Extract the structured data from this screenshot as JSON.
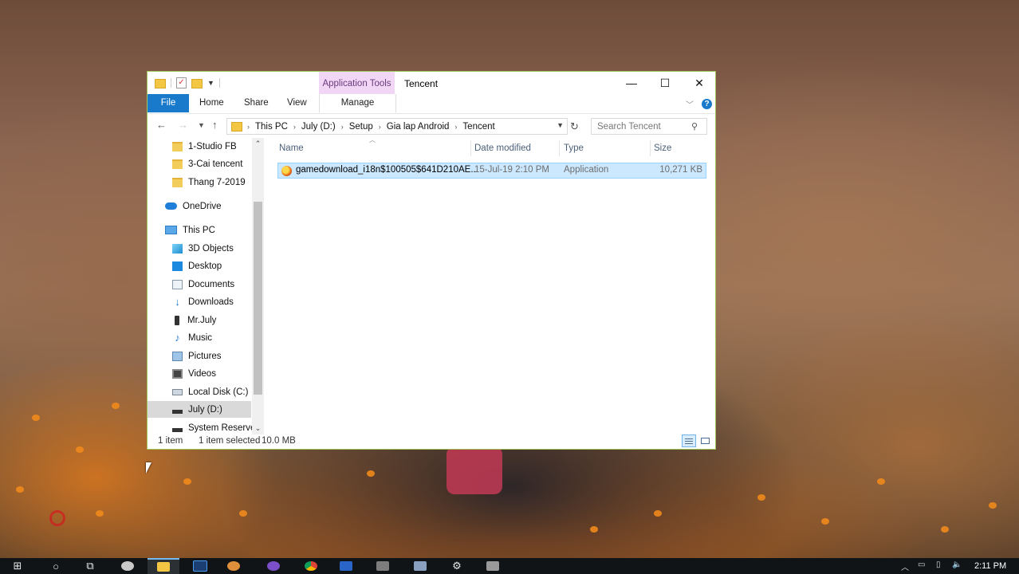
{
  "window": {
    "title": "Tencent",
    "context_tab": "Application Tools",
    "ribbon_tabs": [
      "File",
      "Home",
      "Share",
      "View",
      "Manage"
    ],
    "controls": {
      "minimize": "—",
      "maximize": "☐",
      "close": "✕"
    }
  },
  "address_bar": {
    "path": [
      "This PC",
      "July (D:)",
      "Setup",
      "Gia lap Android",
      "Tencent"
    ]
  },
  "search": {
    "placeholder": "Search Tencent"
  },
  "nav_pane": {
    "items": [
      {
        "label": "1-Studio FB",
        "icon": "folder-icon"
      },
      {
        "label": "3-Cai tencent",
        "icon": "folder-icon"
      },
      {
        "label": "Thang 7-2019",
        "icon": "folder-icon"
      },
      {
        "label": "OneDrive",
        "icon": "onedrive-icon"
      },
      {
        "label": "This PC",
        "icon": "this-pc-icon"
      },
      {
        "label": "3D Objects",
        "icon": "3d-objects-icon"
      },
      {
        "label": "Desktop",
        "icon": "desktop-icon"
      },
      {
        "label": "Documents",
        "icon": "documents-icon"
      },
      {
        "label": "Downloads",
        "icon": "downloads-icon"
      },
      {
        "label": "Mr.July",
        "icon": "phone-icon"
      },
      {
        "label": "Music",
        "icon": "music-icon"
      },
      {
        "label": "Pictures",
        "icon": "pictures-icon"
      },
      {
        "label": "Videos",
        "icon": "videos-icon"
      },
      {
        "label": "Local Disk (C:)",
        "icon": "local-disk-icon"
      },
      {
        "label": "July (D:)",
        "icon": "drive-icon",
        "selected": true
      },
      {
        "label": "System Reservec",
        "icon": "drive-icon"
      }
    ]
  },
  "file_list": {
    "columns": [
      "Name",
      "Date modified",
      "Type",
      "Size"
    ],
    "rows": [
      {
        "name": "gamedownload_i18n$100505$641D210AE...",
        "date": "15-Jul-19 2:10 PM",
        "type": "Application",
        "size": "10,271 KB",
        "selected": true,
        "icon": "application-icon"
      }
    ]
  },
  "status_bar": {
    "item_count": "1 item",
    "selection": "1 item selected",
    "size": "10.0 MB"
  },
  "taskbar": {
    "clock": "2:11 PM",
    "items": [
      "start-icon",
      "search-icon",
      "task-view-icon",
      "paint-icon",
      "file-explorer-icon",
      "photoshop-icon",
      "app-icon",
      "viber-icon",
      "chrome-icon",
      "app-icon",
      "app-icon",
      "app-icon",
      "settings-icon",
      "app-icon"
    ]
  },
  "colors": {
    "accent": "#1979ca",
    "context_tab_bg": "#f1d6f6",
    "selection_bg": "#cce8ff",
    "window_border": "#a3c75b"
  }
}
